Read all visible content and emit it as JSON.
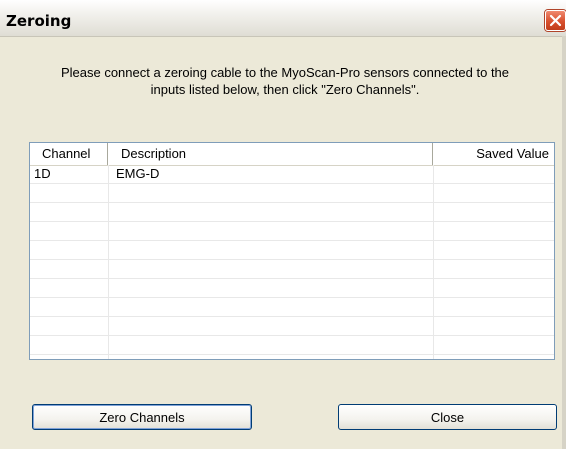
{
  "window": {
    "title": "Zeroing",
    "close_icon": "close-icon"
  },
  "message": {
    "line1": "Please connect a zeroing cable to the MyoScan-Pro sensors connected to the",
    "line2": "inputs listed below, then click \"Zero Channels\"."
  },
  "table": {
    "columns": [
      "Channel",
      "Description",
      "Saved Value"
    ],
    "rows": [
      {
        "channel": "1D",
        "description": "EMG-D",
        "saved_value": ""
      },
      {
        "channel": "",
        "description": "",
        "saved_value": ""
      },
      {
        "channel": "",
        "description": "",
        "saved_value": ""
      },
      {
        "channel": "",
        "description": "",
        "saved_value": ""
      },
      {
        "channel": "",
        "description": "",
        "saved_value": ""
      },
      {
        "channel": "",
        "description": "",
        "saved_value": ""
      },
      {
        "channel": "",
        "description": "",
        "saved_value": ""
      },
      {
        "channel": "",
        "description": "",
        "saved_value": ""
      },
      {
        "channel": "",
        "description": "",
        "saved_value": ""
      },
      {
        "channel": "",
        "description": "",
        "saved_value": ""
      }
    ]
  },
  "buttons": {
    "zero_channels": "Zero Channels",
    "close": "Close"
  },
  "colors": {
    "dialog_background": "#ece9d8",
    "close_button": "#d8502e",
    "button_border": "#003c74"
  }
}
